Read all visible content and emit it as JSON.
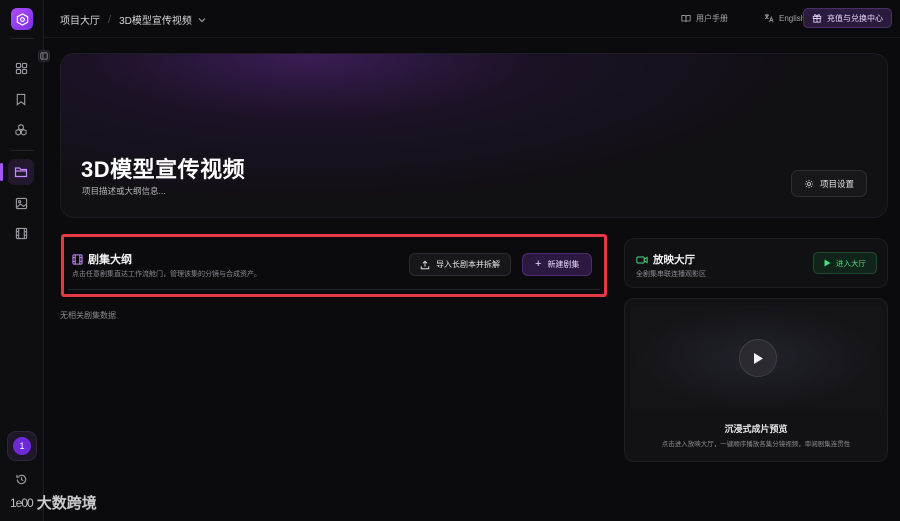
{
  "app": {
    "accent": "#a855f7"
  },
  "sidebar": {
    "items": [
      {
        "icon": "grid-icon"
      },
      {
        "icon": "bookmark-icon"
      },
      {
        "icon": "cubes-icon"
      },
      {
        "icon": "folder-icon",
        "active": true
      },
      {
        "icon": "image-icon"
      },
      {
        "icon": "film-icon"
      }
    ],
    "avatar_label": "1",
    "history_icon": "history-icon"
  },
  "header": {
    "breadcrumb_root": "项目大厅",
    "breadcrumb_current": "3D模型宣传视频",
    "manual_label": "用户手册",
    "language_label": "English",
    "recharge_label": "充值与兑换中心"
  },
  "hero": {
    "title": "3D模型宣传视频",
    "description": "项目描述或大纲信息...",
    "settings_label": "项目设置"
  },
  "episodes": {
    "title": "剧集大纲",
    "subtitle": "点击任意剧集直达工作流舱门，管理该集的分镜与合成资产。",
    "import_label": "导入长剧本并拆解",
    "new_label": "新建剧集",
    "empty_text": "无相关剧集数据",
    "highlight_color": "#e53945"
  },
  "cinema": {
    "title": "放映大厅",
    "subtitle": "全剧集串联连播观影区",
    "enter_label": "进入大厅",
    "preview_title": "沉浸式成片预览",
    "preview_desc": "点击进入放映大厅，一键顺序播放各集分镜视频，审阅剧集连贯性"
  },
  "watermark": {
    "logo": "1e00",
    "text": "大数跨境"
  }
}
